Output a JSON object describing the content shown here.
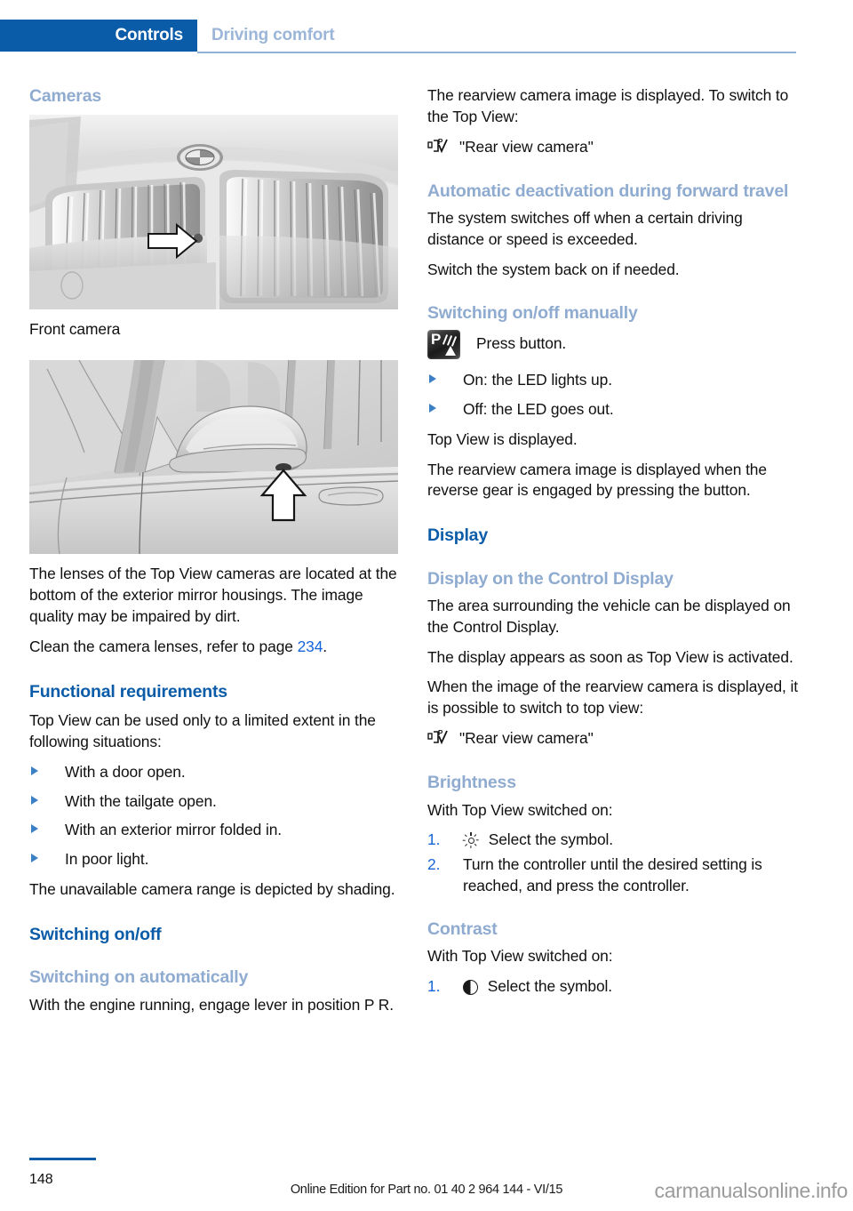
{
  "header": {
    "active_tab": "Controls",
    "sub_tab": "Driving comfort"
  },
  "left_column": {
    "heading_cameras": "Cameras",
    "figure1": {
      "alt": "BMW front grille with front camera location marked by arrow",
      "caption": "Front camera"
    },
    "figure2": {
      "alt": "Exterior mirror housing with Top View camera location marked by arrow"
    },
    "para_lenses": "The lenses of the Top View cameras are located at the bottom of the exterior mirror housings. The image quality may be impaired by dirt.",
    "para_clean_prefix": "Clean the camera lenses, refer to page ",
    "para_clean_pageref": "234",
    "para_clean_suffix": ".",
    "heading_functional": "Functional requirements",
    "para_limited": "Top View can be used only to a limited extent in the following situations:",
    "bullets": [
      "With a door open.",
      "With the tailgate open.",
      "With an exterior mirror folded in.",
      "In poor light."
    ],
    "para_shading": "The unavailable camera range is depicted by shading.",
    "heading_switching": "Switching on/off",
    "heading_switch_auto": "Switching on automatically",
    "para_engine": "With the engine running, engage lever in position P R."
  },
  "right_column": {
    "para_rearview": "The rearview camera image is displayed. To switch to the Top View:",
    "idrive_rear_view_camera": "\"Rear view camera\"",
    "heading_auto_deactivation": "Automatic deactivation during forward travel",
    "para_switches_off": "The system switches off when a certain driving distance or speed is exceeded.",
    "para_switch_back": "Switch the system back on if needed.",
    "heading_switch_manually": "Switching on/off manually",
    "pdc_button_label": "P",
    "para_press_button": "Press button.",
    "bullets": [
      "On: the LED lights up.",
      "Off: the LED goes out."
    ],
    "para_topview_displayed": "Top View is displayed.",
    "para_reverse_gear": "The rearview camera image is displayed when the reverse gear is engaged by pressing the button.",
    "heading_display": "Display",
    "heading_display_control": "Display on the Control Display",
    "para_area_surrounding": "The area surrounding the vehicle can be displayed on the Control Display.",
    "para_appears": "The display appears as soon as Top View is activated.",
    "para_when_image": "When the image of the rearview camera is displayed, it is possible to switch to top view:",
    "idrive_rear_view_camera_2": "\"Rear view camera\"",
    "heading_brightness": "Brightness",
    "para_with_topview_1": "With Top View switched on:",
    "brightness_steps": [
      "Select the symbol.",
      "Turn the controller until the desired setting is reached, and press the controller."
    ],
    "heading_contrast": "Contrast",
    "para_with_topview_2": "With Top View switched on:",
    "contrast_steps": [
      "Select the symbol."
    ]
  },
  "footer": {
    "page_number": "148",
    "edition_note": "Online Edition for Part no. 01 40 2 964 144 - VI/15",
    "watermark": "carmanualsonline.info"
  },
  "colors": {
    "brand_blue": "#0b5ca8",
    "light_blue": "#8fabd0",
    "link_blue": "#1565d8",
    "bullet_blue": "#3b7fc4"
  },
  "numbering": {
    "one": "1.",
    "two": "2."
  }
}
